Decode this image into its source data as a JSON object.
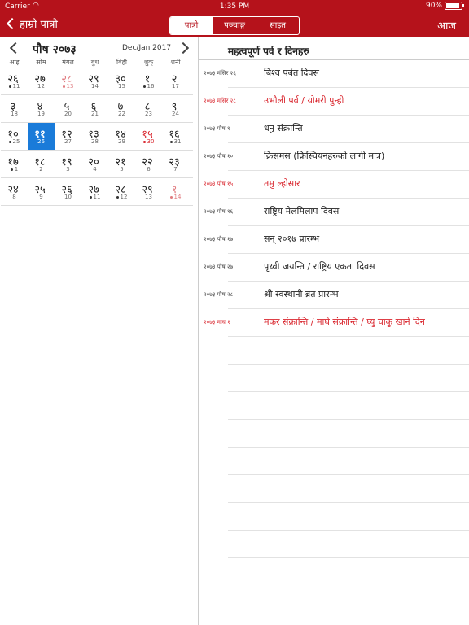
{
  "statusbar": {
    "carrier": "Carrier",
    "time": "1:35 PM",
    "battery": "90%",
    "battery_level": 0.9
  },
  "nav": {
    "back_label": "हाम्रो पात्रो",
    "tabs": [
      "पात्रो",
      "पञ्चाङ्ग",
      "साइत"
    ],
    "active_tab": 0,
    "today_label": "आज"
  },
  "calendar": {
    "month_np": "पौष २०७३",
    "month_en": "Dec/Jan 2017",
    "weekdays": [
      "आइ",
      "सोम",
      "मंगल",
      "बुध",
      "बिही",
      "शुक्",
      "शनी"
    ],
    "weeks": [
      [
        {
          "np": "२६",
          "en": "11",
          "dot": true
        },
        {
          "np": "२७",
          "en": "12"
        },
        {
          "np": "२८",
          "en": "13",
          "dot": true,
          "type": "faded"
        },
        {
          "np": "२९",
          "en": "14"
        },
        {
          "np": "३०",
          "en": "15"
        },
        {
          "np": "१",
          "en": "16",
          "dot": true
        },
        {
          "np": "२",
          "en": "17"
        }
      ],
      [
        {
          "np": "३",
          "en": "18"
        },
        {
          "np": "४",
          "en": "19"
        },
        {
          "np": "५",
          "en": "20"
        },
        {
          "np": "६",
          "en": "21"
        },
        {
          "np": "७",
          "en": "22"
        },
        {
          "np": "८",
          "en": "23"
        },
        {
          "np": "९",
          "en": "24"
        }
      ],
      [
        {
          "np": "१०",
          "en": "25",
          "dot": true
        },
        {
          "np": "११",
          "en": "26",
          "type": "selected"
        },
        {
          "np": "१२",
          "en": "27"
        },
        {
          "np": "१३",
          "en": "28"
        },
        {
          "np": "१४",
          "en": "29"
        },
        {
          "np": "१५",
          "en": "30",
          "dot": true,
          "type": "holiday"
        },
        {
          "np": "१६",
          "en": "31",
          "dot": true
        }
      ],
      [
        {
          "np": "१७",
          "en": "1",
          "dot": true
        },
        {
          "np": "१८",
          "en": "2"
        },
        {
          "np": "१९",
          "en": "3"
        },
        {
          "np": "२०",
          "en": "4"
        },
        {
          "np": "२१",
          "en": "5"
        },
        {
          "np": "२२",
          "en": "6"
        },
        {
          "np": "२३",
          "en": "7"
        }
      ],
      [
        {
          "np": "२४",
          "en": "8"
        },
        {
          "np": "२५",
          "en": "9"
        },
        {
          "np": "२६",
          "en": "10"
        },
        {
          "np": "२७",
          "en": "11",
          "dot": true
        },
        {
          "np": "२८",
          "en": "12",
          "dot": true
        },
        {
          "np": "२९",
          "en": "13"
        },
        {
          "np": "१",
          "en": "14",
          "dot": true,
          "type": "faded"
        }
      ]
    ]
  },
  "events": {
    "title": "महत्वपूर्ण पर्व र दिनहरु",
    "items": [
      {
        "date": "२०७३ मंसिर २६",
        "name": "बिश्व पर्बत दिवस",
        "red": false
      },
      {
        "date": "२०७३ मंसिर २८",
        "name": "उभौली पर्व / योमरी पुन्ही",
        "red": true
      },
      {
        "date": "२०७३ पौष १",
        "name": "धनु संक्रान्ति",
        "red": false
      },
      {
        "date": "२०७३ पौष १०",
        "name": "क्रिसमस (क्रिस्चियनहरुको लागी मात्र)",
        "red": false
      },
      {
        "date": "२०७३ पौष १५",
        "name": "तमु ल्होसार",
        "red": true
      },
      {
        "date": "२०७३ पौष १६",
        "name": "राष्ट्रिय मेलमिलाप दिवस",
        "red": false
      },
      {
        "date": "२०७३ पौष १७",
        "name": "सन् २०१७ प्रारम्भ",
        "red": false
      },
      {
        "date": "२०७३ पौष २७",
        "name": "पृथ्वी जयन्ति / राष्ट्रिय एकता दिवस",
        "red": false
      },
      {
        "date": "२०७३ पौष २८",
        "name": "श्री स्वस्थानी ब्रत प्रारम्भ",
        "red": false
      },
      {
        "date": "२०७३ माघ १",
        "name": "मकर संक्रान्ति / माघे संक्रान्ति / घ्यु चाकु खाने दिन",
        "red": true
      }
    ]
  }
}
